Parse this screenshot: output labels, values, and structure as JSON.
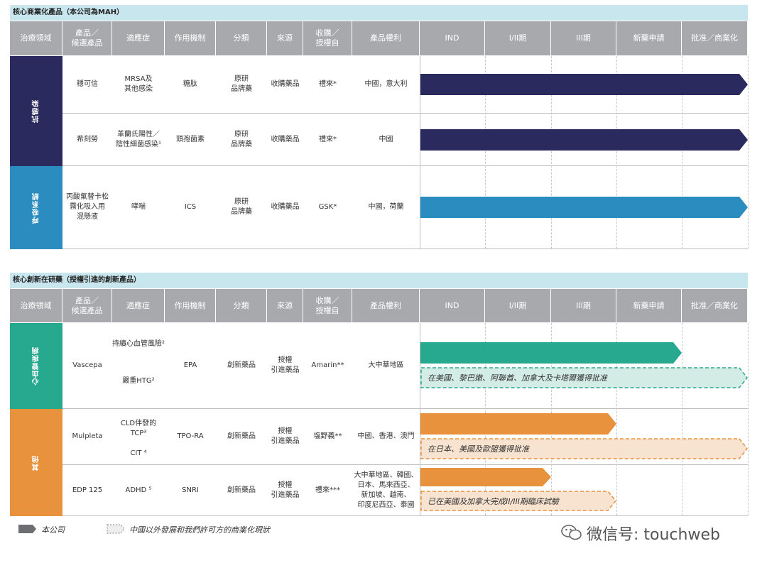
{
  "section1": {
    "title": "核心商業化產品（本公司為MAH）",
    "headers": [
      "治療領域",
      "產品／\n候選產品",
      "適應症",
      "作用機制",
      "分類",
      "來源",
      "收購／\n授權自",
      "產品權利",
      "IND",
      "I/II期",
      "III期",
      "新藥申請",
      "批准／商業化"
    ],
    "areas": [
      {
        "label": "抗感染",
        "color": "#2b2a5e"
      },
      {
        "label": "呼吸系統",
        "color": "#2b8cbf"
      }
    ],
    "rows": [
      {
        "product": "穩可信",
        "indication": "MRSA及\n其他感染",
        "mechanism": "糖肽",
        "category": "原研\n品牌藥",
        "source": "收購藥品",
        "partner": "禮來*",
        "rights": "中國，意大利",
        "stage": "批准／商業化",
        "bar_color": "#2b2a5e"
      },
      {
        "product": "希刻勞",
        "indication": "革蘭氏陽性／\n陰性細菌感染¹",
        "mechanism": "頭孢菌素",
        "category": "原研\n品牌藥",
        "source": "收購藥品",
        "partner": "禮來*",
        "rights": "中國",
        "stage": "批准／商業化",
        "bar_color": "#2b2a5e"
      },
      {
        "product": "丙酸氟替卡松\n霧化吸入用\n混懸液",
        "indication": "哮喘",
        "mechanism": "ICS",
        "category": "原研\n品牌藥",
        "source": "收購藥品",
        "partner": "GSK*",
        "rights": "中國，荷蘭",
        "stage": "批准／商業化",
        "bar_color": "#2b8cbf"
      }
    ]
  },
  "section2": {
    "title": "核心創新在研藥（授權引進的創新產品）",
    "headers": [
      "治療領域",
      "產品／\n候選產品",
      "適應症",
      "作用機制",
      "分類",
      "來源",
      "收購／\n授權自",
      "產品權利",
      "IND",
      "I/II期",
      "III期",
      "新藥申請",
      "批准／商業化"
    ],
    "areas": [
      {
        "label": "心血管疾病",
        "color": "#27a98f"
      },
      {
        "label": "其他",
        "color": "#e8923e"
      }
    ],
    "rows": [
      {
        "product": "Vascepa",
        "indication_a": "持續心血管風險²",
        "indication_b": "嚴重HTG²",
        "mechanism": "EPA",
        "category": "創新藥品",
        "source": "授權\n引進藥品",
        "partner": "Amarin**",
        "rights": "大中華地區",
        "stage": "新藥申請",
        "bar_color": "#27a98f",
        "overseas": "在美國、黎巴嫩、阿聯酋、加拿大及卡塔爾獲得批准"
      },
      {
        "product": "Mulpleta",
        "indication_a": "CLD伴發的\nTCP³",
        "indication_b": "CIT ⁴",
        "mechanism": "TPO-RA",
        "category": "創新藥品",
        "source": "授權\n引進藥品",
        "partner": "塩野義**",
        "rights": "中國、香港、澳門",
        "stage": "III期",
        "bar_color": "#e8923e",
        "overseas": "在日本、美國及歐盟獲得批准"
      },
      {
        "product": "EDP 125",
        "indication": "ADHD ⁵",
        "mechanism": "SNRI",
        "category": "創新藥品",
        "source": "授權\n引進藥品",
        "partner": "禮來***",
        "rights": "大中華地區、韓國、\n日本、馬來西亞、\n新加坡、越南、\n印度尼西亞、泰國",
        "stage": "I/II期",
        "bar_color": "#e8923e",
        "overseas": "已在美國及加拿大完成II/III期臨床試驗"
      }
    ]
  },
  "legend": {
    "company": "本公司",
    "partner": "中國以外發展和我們許可方的商業化現狀"
  },
  "watermark": "微信号: touchweb"
}
